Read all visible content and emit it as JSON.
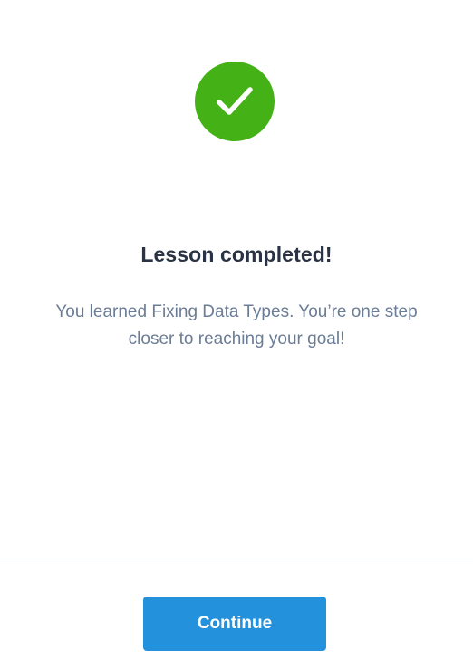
{
  "modal": {
    "icon": "checkmark-circle-icon",
    "title": "Lesson completed!",
    "message": "You learned Fixing Data Types. You’re one step closer to reaching your goal!",
    "continue_label": "Continue"
  },
  "colors": {
    "success": "#44b216",
    "primary": "#2491dc",
    "title_text": "#2a3343",
    "body_text": "#6b7c95"
  }
}
